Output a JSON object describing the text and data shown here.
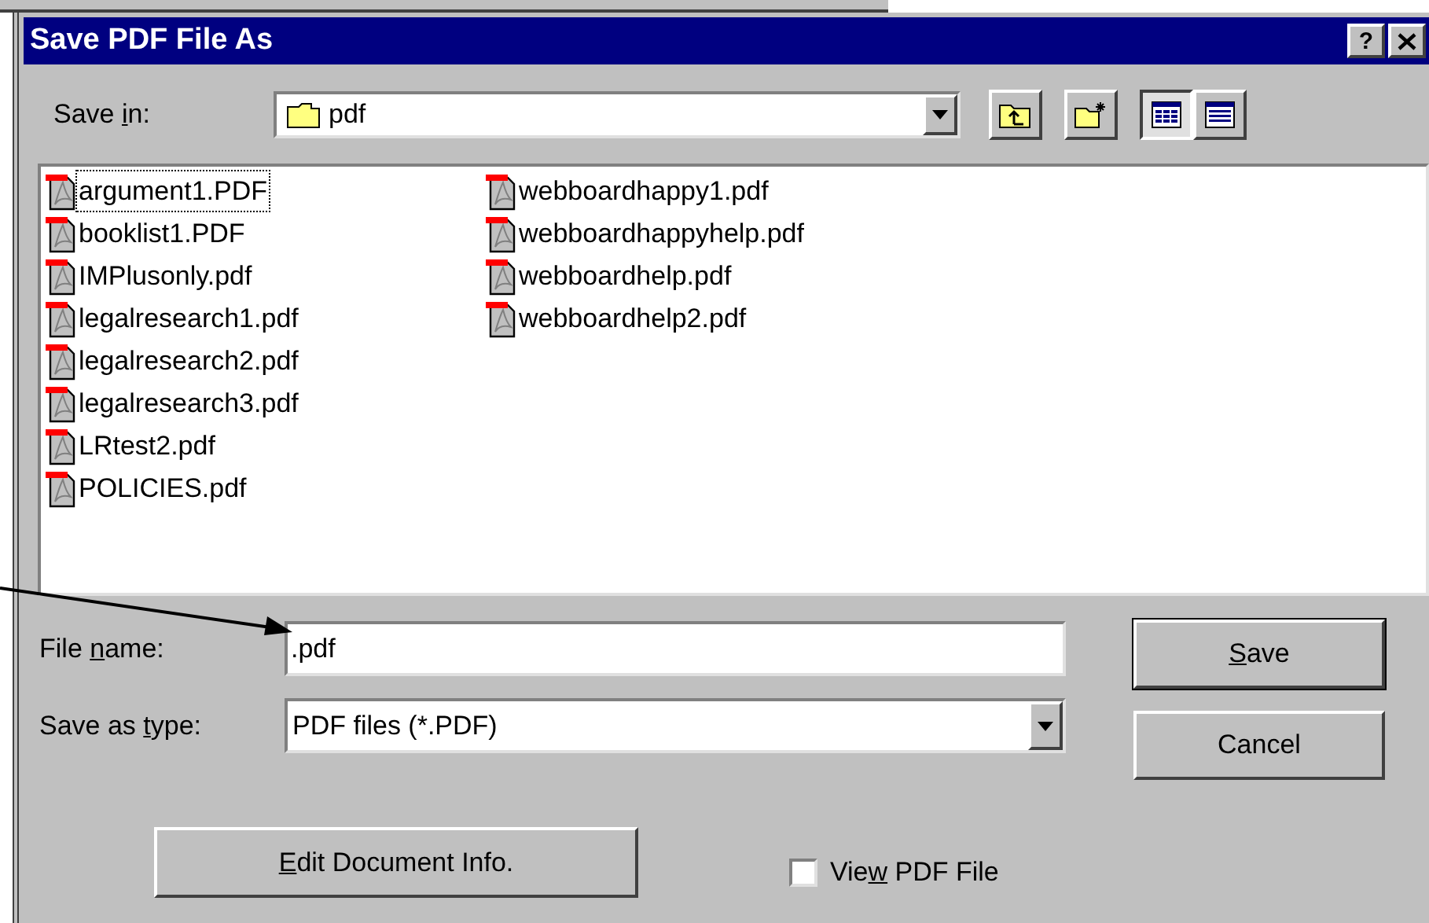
{
  "window": {
    "title": "Save PDF File As",
    "help": "?"
  },
  "save_in": {
    "label": {
      "pre": "Save ",
      "key": "i",
      "post": "n:"
    },
    "value": "pdf"
  },
  "toolbar": [
    {
      "kind": "up-folder",
      "selected": false
    },
    {
      "kind": "new-folder",
      "selected": false
    },
    {
      "kind": "list-view",
      "selected": true
    },
    {
      "kind": "details-view",
      "selected": false
    }
  ],
  "files": [
    {
      "name": "argument1.PDF",
      "focused": true
    },
    {
      "name": "booklist1.PDF",
      "focused": false
    },
    {
      "name": "IMPlusonly.pdf",
      "focused": false
    },
    {
      "name": "legalresearch1.pdf",
      "focused": false
    },
    {
      "name": "legalresearch2.pdf",
      "focused": false
    },
    {
      "name": "legalresearch3.pdf",
      "focused": false
    },
    {
      "name": "LRtest2.pdf",
      "focused": false
    },
    {
      "name": "POLICIES.pdf",
      "focused": false
    },
    {
      "name": "webboardhappy1.pdf",
      "focused": false
    },
    {
      "name": "webboardhappyhelp.pdf",
      "focused": false
    },
    {
      "name": "webboardhelp.pdf",
      "focused": false
    },
    {
      "name": "webboardhelp2.pdf",
      "focused": false
    }
  ],
  "file_name": {
    "label": {
      "pre": "File ",
      "key": "n",
      "post": "ame:"
    },
    "value": ".pdf"
  },
  "save_as_type": {
    "label": {
      "pre": "Save as ",
      "key": "t",
      "post": "ype:"
    },
    "value": "PDF files (*.PDF)"
  },
  "save_button": {
    "key": "S",
    "post": "ave"
  },
  "cancel_button": {
    "pre": "Cancel"
  },
  "edit_info_button": {
    "key": "E",
    "post": "dit Document Info."
  },
  "view_pdf": {
    "label": {
      "pre": "Vie",
      "key": "w",
      "post": " PDF File"
    },
    "checked": false
  }
}
